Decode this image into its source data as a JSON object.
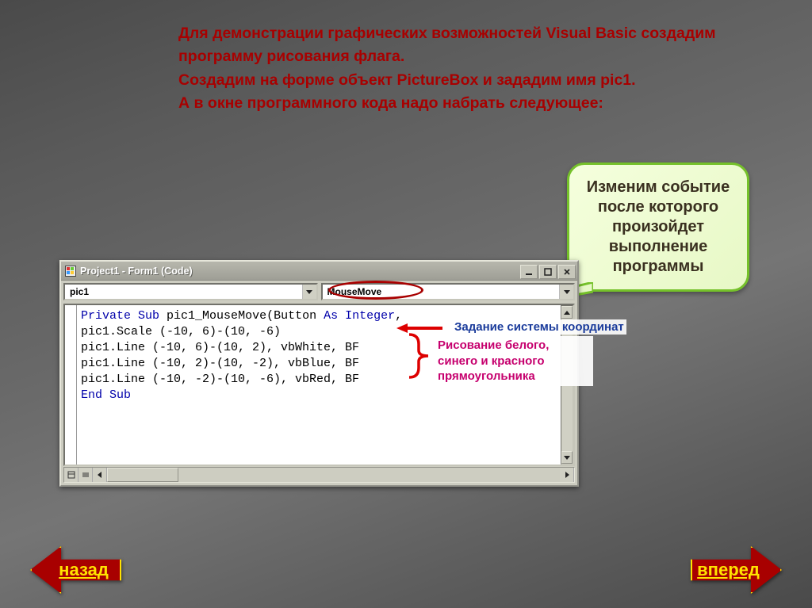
{
  "intro": {
    "line1": "Для демонстрации графических возможностей Visual Basic создадим программу рисования флага.",
    "line2": "Создадим на форме объект PictureBox и зададим имя pic1.",
    "line3": "А в окне программного кода надо набрать следующее:"
  },
  "window": {
    "title": "Project1 - Form1 (Code)",
    "combo_left": "pic1",
    "combo_right": "MouseMove"
  },
  "code": {
    "kw_private": "Private",
    "kw_sub": "Sub",
    "kw_as": "As",
    "kw_integer": "Integer",
    "kw_end_sub": "End Sub",
    "line1_rest": " pic1_MouseMove(Button ",
    "line2": "pic1.Scale (-10, 6)-(10, -6)",
    "line3": "pic1.Line (-10, 6)-(10, 2), vbWhite, BF",
    "line4": "pic1.Line (-10, 2)-(10, -2), vbBlue, BF",
    "line5": "pic1.Line (-10, -2)-(10, -6), vbRed, BF"
  },
  "callout": {
    "text": "Изменим событие после которого произойдет выполнение программы"
  },
  "annotations": {
    "coords": "Задание системы координат",
    "rects": "Рисование белого, синего и красного прямоугольника"
  },
  "nav": {
    "back": "назад",
    "forward": "вперед"
  }
}
